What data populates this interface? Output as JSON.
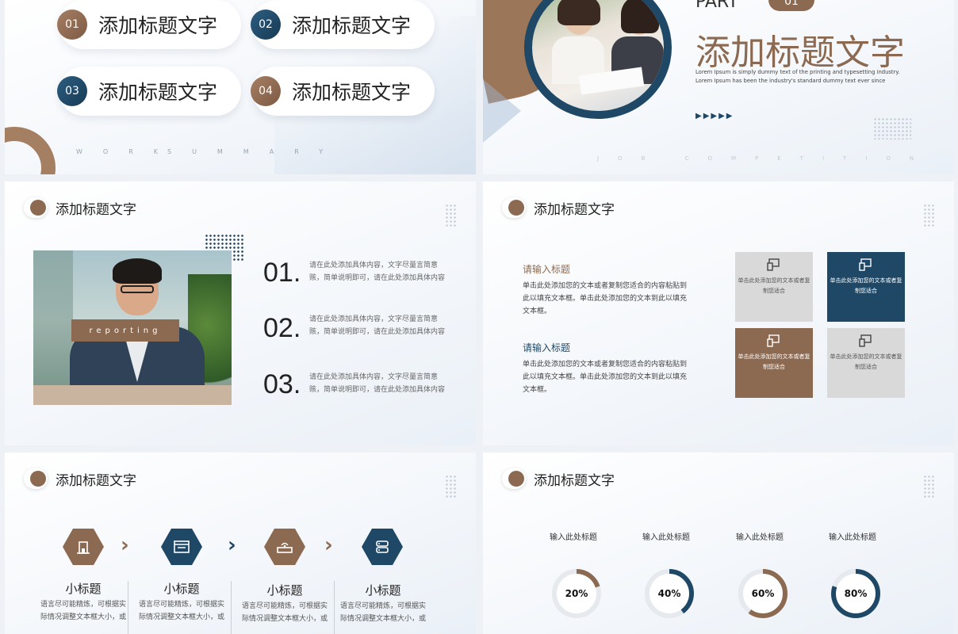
{
  "colors": {
    "brown": "#8c6a52",
    "navy": "#1f4866",
    "gray_tile": "#d9d9d9"
  },
  "slide1": {
    "items": [
      {
        "num": "01",
        "label": "添加标题文字"
      },
      {
        "num": "02",
        "label": "添加标题文字"
      },
      {
        "num": "03",
        "label": "添加标题文字"
      },
      {
        "num": "04",
        "label": "添加标题文字"
      }
    ],
    "footer_a": "WORK",
    "footer_b": "SUMMARY"
  },
  "slide2": {
    "part_label": "PART",
    "part_num": "01",
    "title": "添加标题文字",
    "desc1": "Lorem Ipsum is simply dummy text of the printing and typesetting industry.",
    "desc2": "Lorem Ipsum has been the industry's standard dummy text ever since",
    "arrows": "▶▶▶▶▶",
    "footer": "JOB COMPETITION"
  },
  "slide3": {
    "header": "添加标题文字",
    "photo_tag": "reporting",
    "items": [
      {
        "num": "01.",
        "text": "请在此处添加具体内容，文字尽量言简意赅，简单说明即可，请在此处添加具体内容"
      },
      {
        "num": "02.",
        "text": "请在此处添加具体内容，文字尽量言简意赅，简单说明即可，请在此处添加具体内容"
      },
      {
        "num": "03.",
        "text": "请在此处添加具体内容，文字尽量言简意赅，简单说明即可，请在此处添加具体内容"
      }
    ]
  },
  "slide4": {
    "header": "添加标题文字",
    "blocks": [
      {
        "title": "请输入标题",
        "text": "单击此处添加您的文本或者复制您适合的内容粘贴到此以填充文本框。单击此处添加您的文本到此以填充文本框。"
      },
      {
        "title": "请输入标题",
        "text": "单击此处添加您的文本或者复制您适合的内容粘贴到此以填充文本框。单击此处添加您的文本到此以填充文本框。"
      }
    ],
    "tiles": [
      {
        "icon": "devices-icon",
        "text": "单击此处添加您的文本或者复制您适合"
      },
      {
        "icon": "devices-icon",
        "text": "单击此处添加您的文本或者复制您适合"
      },
      {
        "icon": "devices-icon",
        "text": "单击此处添加您的文本或者复制您适合"
      },
      {
        "icon": "devices-icon",
        "text": "单击此处添加您的文本或者复制您适合"
      }
    ]
  },
  "slide5": {
    "header": "添加标题文字",
    "steps": [
      {
        "icon": "building-icon",
        "title": "小标题",
        "text": "语言尽可能精炼，可根据实际情况调整文本框大小，或"
      },
      {
        "icon": "browser-icon",
        "title": "小标题",
        "text": "语言尽可能精炼，可根据实际情况调整文本框大小，或"
      },
      {
        "icon": "router-icon",
        "title": "小标题",
        "text": "语言尽可能精炼，可根据实际情况调整文本框大小，或"
      },
      {
        "icon": "server-icon",
        "title": "小标题",
        "text": "语言尽可能精炼，可根据实际情况调整文本框大小，或"
      }
    ]
  },
  "slide6": {
    "header": "添加标题文字",
    "rings": [
      {
        "label": "输入此处标题",
        "percent": 20,
        "value_text": "20%",
        "color": "#8c6a52"
      },
      {
        "label": "输入此处标题",
        "percent": 40,
        "value_text": "40%",
        "color": "#1f4866"
      },
      {
        "label": "输入此处标题",
        "percent": 60,
        "value_text": "60%",
        "color": "#8c6a52"
      },
      {
        "label": "输入此处标题",
        "percent": 80,
        "value_text": "80%",
        "color": "#1f4866"
      }
    ]
  }
}
